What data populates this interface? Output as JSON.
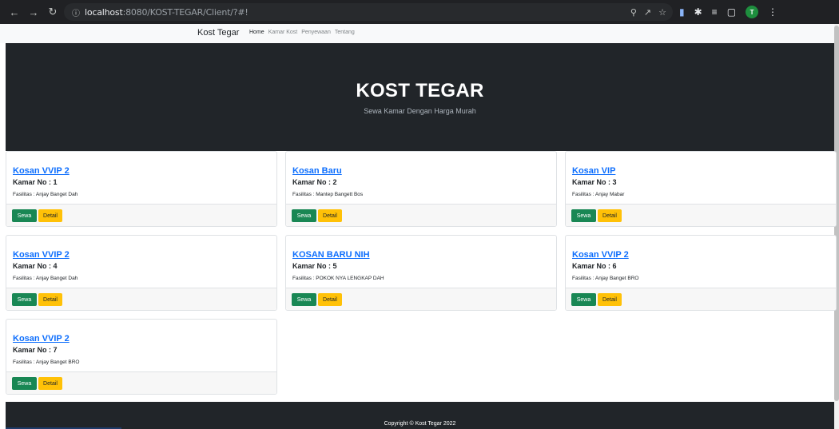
{
  "browser": {
    "url_host": "localhost",
    "url_path": ":8080/KOST-TEGAR/Client/?#!",
    "avatar_letter": "T"
  },
  "navbar": {
    "brand": "Kost Tegar",
    "links": [
      "Home",
      "Kamar Kost",
      "Penyewaan",
      "Tentang"
    ]
  },
  "hero": {
    "title": "KOST TEGAR",
    "subtitle": "Sewa Kamar Dengan Harga Murah"
  },
  "cards": [
    {
      "title": "Kosan VVIP 2",
      "room": "Kamar No : 1",
      "facilities": "Fasilitas : Anjay Banget Dah",
      "sewa": "Sewa",
      "detail": "Detail"
    },
    {
      "title": "Kosan Baru",
      "room": "Kamar No : 2",
      "facilities": "Fasilitas : Mantep Bangett Bos",
      "sewa": "Sewa",
      "detail": "Detail"
    },
    {
      "title": "Kosan VIP",
      "room": "Kamar No : 3",
      "facilities": "Fasilitas : Anjay Mabar",
      "sewa": "Sewa",
      "detail": "Detail"
    },
    {
      "title": "Kosan VVIP 2",
      "room": "Kamar No : 4",
      "facilities": "Fasilitas : Anjay Banget Dah",
      "sewa": "Sewa",
      "detail": "Detail"
    },
    {
      "title": "KOSAN BARU NIH",
      "room": "Kamar No : 5",
      "facilities": "Fasilitas : POKOK NYA LENGKAP DAH",
      "sewa": "Sewa",
      "detail": "Detail"
    },
    {
      "title": "Kosan VVIP 2",
      "room": "Kamar No : 6",
      "facilities": "Fasilitas : Anjay Banget BRO",
      "sewa": "Sewa",
      "detail": "Detail"
    },
    {
      "title": "Kosan VVIP 2",
      "room": "Kamar No : 7",
      "facilities": "Fasilitas : Anjay Banget BRO",
      "sewa": "Sewa",
      "detail": "Detail"
    }
  ],
  "footer": {
    "copyright": "Copyright © Kost Tegar 2022"
  },
  "colors": {
    "dark": "#212529",
    "success": "#198754",
    "warning": "#ffc107",
    "link": "#0d6efd"
  }
}
